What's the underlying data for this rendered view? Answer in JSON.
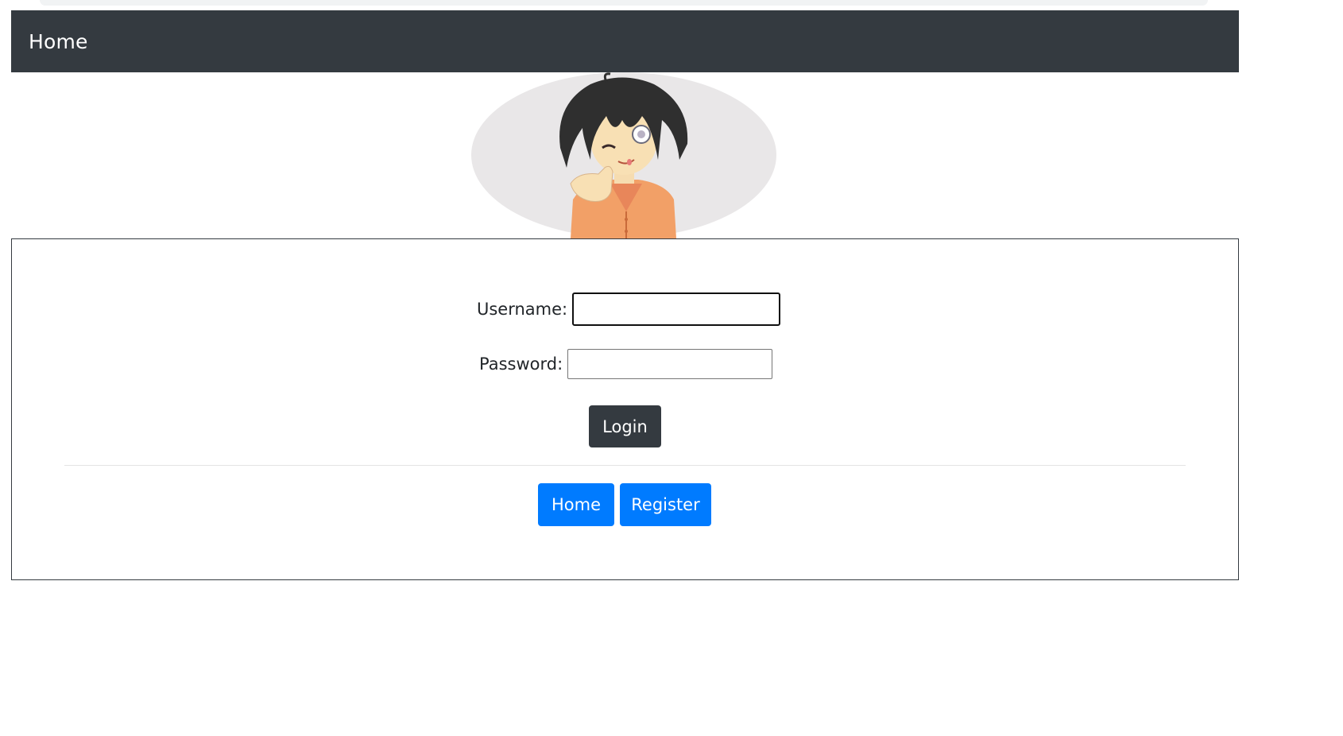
{
  "navbar": {
    "brand": "Home"
  },
  "avatar": {
    "icon": "anime-avatar-image"
  },
  "login_form": {
    "username_label": "Username:",
    "username_value": "",
    "password_label": "Password:",
    "password_value": "",
    "login_button": "Login"
  },
  "footer_nav": {
    "home_button": "Home",
    "register_button": "Register"
  },
  "colors": {
    "navbar_bg": "#343a40",
    "primary": "#007bff",
    "dark_button": "#343a40"
  }
}
